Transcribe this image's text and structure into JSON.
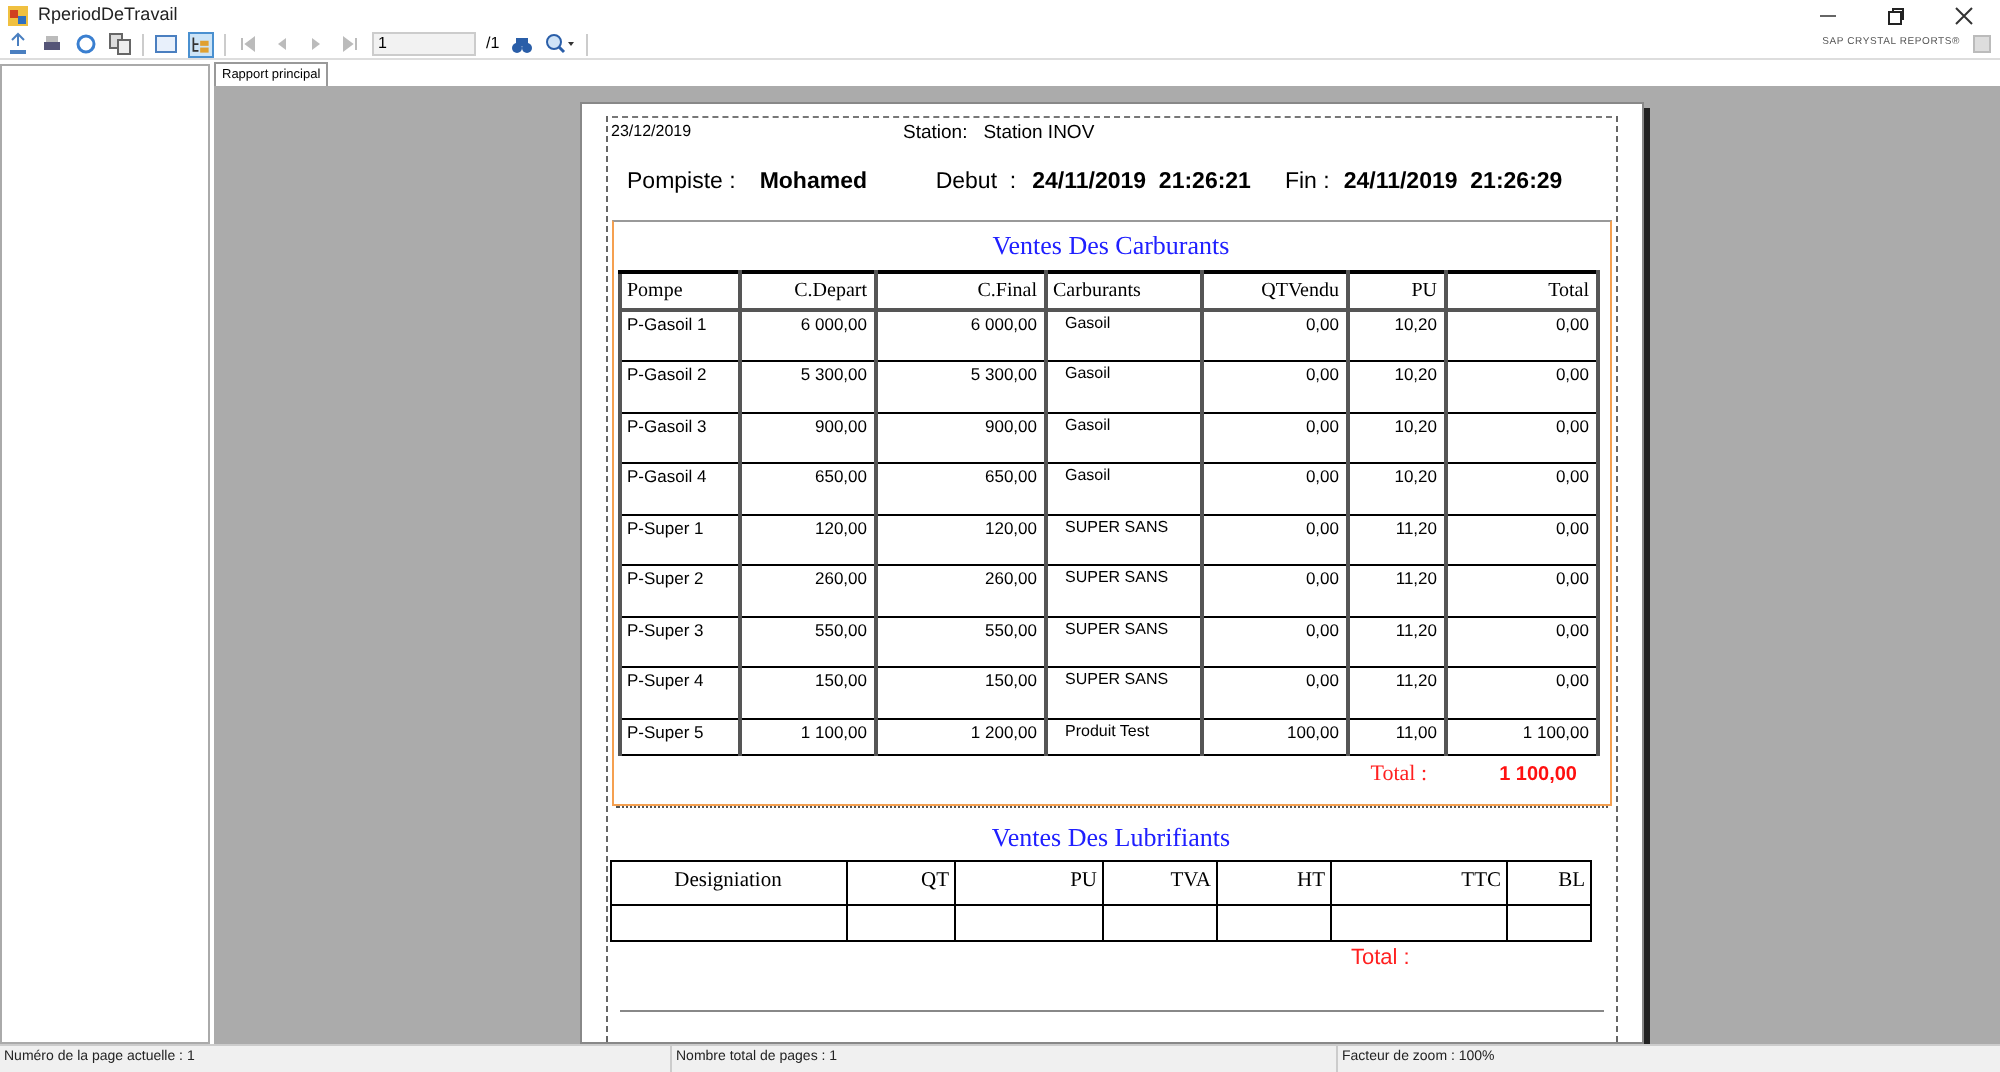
{
  "window": {
    "title": "RperiodDeTravail"
  },
  "toolbar": {
    "page_number": "1",
    "page_total": "/1",
    "brand": "SAP CRYSTAL REPORTS®"
  },
  "tabs": [
    {
      "label": "Rapport principal",
      "selected": true
    }
  ],
  "report": {
    "date": "23/12/2019",
    "station_label": "Station:",
    "station": "Station INOV",
    "pompiste_label": "Pompiste :",
    "pompiste": "Mohamed",
    "debut_label": "Debut  :",
    "debut": "24/11/2019  21:26:21",
    "fin_label": "Fin :",
    "fin": "24/11/2019  21:26:29"
  },
  "carburants": {
    "title": "Ventes Des Carburants",
    "columns": [
      "Pompe",
      "C.Depart",
      "C.Final",
      "Carburants",
      "QTVendu",
      "PU",
      "Total"
    ],
    "rows": [
      [
        "P-Gasoil 1",
        "6 000,00",
        "6 000,00",
        "Gasoil",
        "0,00",
        "10,20",
        "0,00"
      ],
      [
        "P-Gasoil 2",
        "5 300,00",
        "5 300,00",
        "Gasoil",
        "0,00",
        "10,20",
        "0,00"
      ],
      [
        "P-Gasoil 3",
        "900,00",
        "900,00",
        "Gasoil",
        "0,00",
        "10,20",
        "0,00"
      ],
      [
        "P-Gasoil 4",
        "650,00",
        "650,00",
        "Gasoil",
        "0,00",
        "10,20",
        "0,00"
      ],
      [
        "P-Super 1",
        "120,00",
        "120,00",
        "SUPER SANS",
        "0,00",
        "11,20",
        "0,00"
      ],
      [
        "P-Super 2",
        "260,00",
        "260,00",
        "SUPER SANS",
        "0,00",
        "11,20",
        "0,00"
      ],
      [
        "P-Super 3",
        "550,00",
        "550,00",
        "SUPER SANS",
        "0,00",
        "11,20",
        "0,00"
      ],
      [
        "P-Super 4",
        "150,00",
        "150,00",
        "SUPER SANS",
        "0,00",
        "11,20",
        "0,00"
      ],
      [
        "P-Super 5",
        "1 100,00",
        "1 200,00",
        "Produit Test",
        "100,00",
        "11,00",
        "1 100,00"
      ]
    ],
    "total_label": "Total :",
    "total": "1 100,00"
  },
  "lubrifiants": {
    "title": "Ventes Des Lubrifiants",
    "columns": [
      "Designiation",
      "QT",
      "PU",
      "TVA",
      "HT",
      "TTC",
      "BL"
    ],
    "total_label": "Total :"
  },
  "status_bar": [
    "Numéro de la page actuelle : 1",
    "Nombre total de pages : 1",
    "Facteur de zoom : 100%"
  ]
}
